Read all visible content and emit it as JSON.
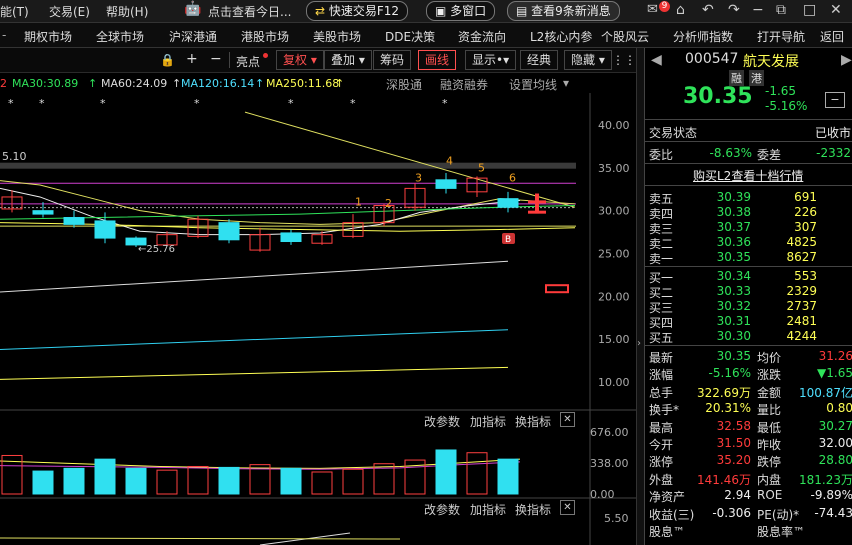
{
  "menubar": {
    "items": [
      "能(T)",
      "交易(E)",
      "帮助(H)"
    ],
    "promo": "点击查看今日...",
    "quick_trade": "快速交易F12",
    "multi_window": "多窗口",
    "news": "查看9条新消息",
    "badge": "9"
  },
  "navbar": {
    "items": [
      "期权市场",
      "全球市场",
      "沪深港通",
      "港股市场",
      "美股市场",
      "DDE决策",
      "资金流向",
      "L2核心内参",
      "个股风云",
      "分析师指数",
      "打开导航",
      "返回"
    ]
  },
  "toolbar": {
    "items": [
      "亮点",
      "复权",
      "叠加",
      "筹码",
      "画线",
      "显示",
      "经典",
      "隐藏"
    ]
  },
  "ma_line": {
    "ma30": "MA30:30.89",
    "ma60": "MA60:24.09",
    "ma120": "MA120:16.14",
    "ma250": "MA250:11.68",
    "tabs": [
      "深股通",
      "融资融券",
      "设置均线"
    ]
  },
  "chart_data": {
    "type": "candlestick",
    "y_ticks": [
      "40.00",
      "35.00",
      "30.00",
      "25.00",
      "20.00",
      "15.00",
      "10.00"
    ],
    "ylim": [
      7.5,
      42
    ],
    "ma_levels": [
      30.89,
      24.09,
      16.14,
      11.68
    ],
    "prev_high_label": "5.10",
    "low_label": "←25.76",
    "wave_labels": [
      "1",
      "2",
      "3",
      "4",
      "5",
      "6"
    ],
    "candles": [
      {
        "o": 30.2,
        "c": 31.6,
        "h": 32.4,
        "l": 29.8
      },
      {
        "o": 30.0,
        "c": 29.6,
        "h": 31.0,
        "l": 29.2
      },
      {
        "o": 29.2,
        "c": 28.4,
        "h": 30.0,
        "l": 28.0
      },
      {
        "o": 28.8,
        "c": 26.8,
        "h": 29.8,
        "l": 26.2
      },
      {
        "o": 26.8,
        "c": 26.0,
        "h": 27.0,
        "l": 25.76
      },
      {
        "o": 26.0,
        "c": 27.2,
        "h": 27.6,
        "l": 25.9
      },
      {
        "o": 27.0,
        "c": 29.0,
        "h": 29.4,
        "l": 26.8
      },
      {
        "o": 28.6,
        "c": 26.6,
        "h": 29.0,
        "l": 26.2
      },
      {
        "o": 25.4,
        "c": 27.2,
        "h": 28.0,
        "l": 25.2
      },
      {
        "o": 27.4,
        "c": 26.4,
        "h": 27.8,
        "l": 26.0
      },
      {
        "o": 26.2,
        "c": 27.2,
        "h": 27.6,
        "l": 26.0
      },
      {
        "o": 27.0,
        "c": 28.6,
        "h": 29.6,
        "l": 26.8
      },
      {
        "o": 28.6,
        "c": 30.6,
        "h": 30.8,
        "l": 28.2
      },
      {
        "o": 30.4,
        "c": 32.6,
        "h": 33.2,
        "l": 30.0
      },
      {
        "o": 33.6,
        "c": 32.6,
        "h": 34.4,
        "l": 32.0
      },
      {
        "o": 32.2,
        "c": 33.8,
        "h": 34.0,
        "l": 31.6
      },
      {
        "o": 31.4,
        "c": 30.4,
        "h": 32.2,
        "l": 29.8
      }
    ],
    "volume_ticks": [
      "676.00",
      "338.00",
      "0.00"
    ],
    "volumes": [
      420,
      250,
      280,
      380,
      280,
      260,
      300,
      290,
      320,
      280,
      240,
      270,
      330,
      370,
      480,
      450,
      380
    ],
    "indicator_ticks": [
      "5.50"
    ],
    "panel_buttons": [
      "改参数",
      "加指标",
      "换指标"
    ]
  },
  "quote": {
    "code": "000547",
    "name": "航天发展",
    "tag1": "融",
    "tag2": "港",
    "price": "30.35",
    "change": "-1.65",
    "change_pct": "-5.16%",
    "status_label": "交易状态",
    "status_value": "已收市",
    "wb_label": "委比",
    "wb_value": "-8.63%",
    "wc_label": "委差",
    "wc_value": "-2332",
    "l2_link": "购买L2查看十档行情",
    "asks": [
      {
        "label": "卖五",
        "price": "30.39",
        "vol": "691"
      },
      {
        "label": "卖四",
        "price": "30.38",
        "vol": "226"
      },
      {
        "label": "卖三",
        "price": "30.37",
        "vol": "307"
      },
      {
        "label": "卖二",
        "price": "30.36",
        "vol": "4825"
      },
      {
        "label": "卖一",
        "price": "30.35",
        "vol": "8627"
      }
    ],
    "bids": [
      {
        "label": "买一",
        "price": "30.34",
        "vol": "553"
      },
      {
        "label": "买二",
        "price": "30.33",
        "vol": "2329"
      },
      {
        "label": "买三",
        "price": "30.32",
        "vol": "2737"
      },
      {
        "label": "买四",
        "price": "30.31",
        "vol": "2481"
      },
      {
        "label": "买五",
        "price": "30.30",
        "vol": "4244"
      }
    ],
    "stats": [
      {
        "l1": "最新",
        "v1": "30.35",
        "c1": "grn",
        "l2": "均价",
        "v2": "31.26",
        "c2": "red"
      },
      {
        "l1": "涨幅",
        "v1": "-5.16%",
        "c1": "grn",
        "l2": "涨跌",
        "v2": "▼1.65",
        "c2": "grn"
      },
      {
        "l1": "总手",
        "v1": "322.69万",
        "c1": "yel",
        "l2": "金额",
        "v2": "100.87亿",
        "c2": "cyan"
      },
      {
        "l1": "换手*",
        "v1": "20.31%",
        "c1": "yel",
        "l2": "量比",
        "v2": "0.80",
        "c2": "yel"
      },
      {
        "l1": "最高",
        "v1": "32.58",
        "c1": "red",
        "l2": "最低",
        "v2": "30.27",
        "c2": "grn"
      },
      {
        "l1": "今开",
        "v1": "31.50",
        "c1": "red",
        "l2": "昨收",
        "v2": "32.00",
        "c2": "wht"
      },
      {
        "l1": "涨停",
        "v1": "35.20",
        "c1": "red",
        "l2": "跌停",
        "v2": "28.80",
        "c2": "grn"
      },
      {
        "l1": "外盘",
        "v1": "141.46万",
        "c1": "red",
        "l2": "内盘",
        "v2": "181.23万",
        "c2": "grn"
      },
      {
        "l1": "净资产",
        "v1": "2.94",
        "c1": "wht",
        "l2": "ROE",
        "v2": "-9.89%",
        "c2": "wht"
      },
      {
        "l1": "收益(三)",
        "v1": "-0.306",
        "c1": "wht",
        "l2": "PE(动)*",
        "v2": "-74.43",
        "c2": "wht"
      },
      {
        "l1": "股息™",
        "v1": "",
        "c1": "wht",
        "l2": "股息率™",
        "v2": "",
        "c2": "wht"
      }
    ]
  }
}
